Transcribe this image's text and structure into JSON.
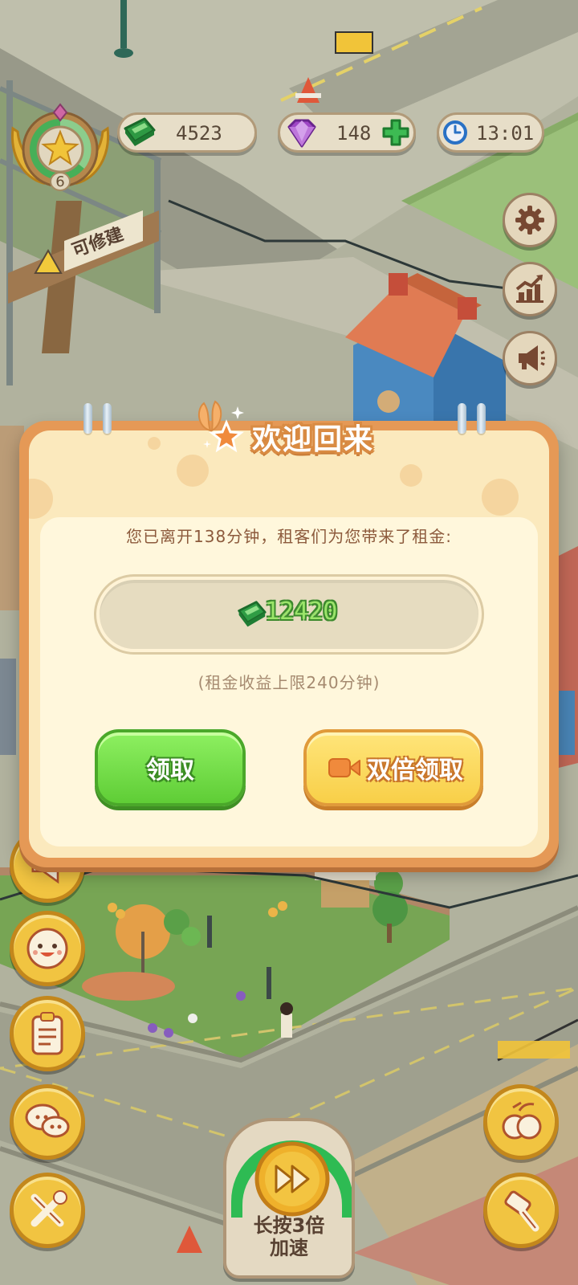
{
  "hud": {
    "level": "6",
    "cash": "4523",
    "gems": "148",
    "time": "13:01"
  },
  "sign": {
    "construction_label": "可修建"
  },
  "dialog": {
    "title": "欢迎回来",
    "away_message": "您已离开138分钟，租客们为您带来了租金:",
    "reward_amount": "12420",
    "cap_note": "(租金收益上限240分钟)",
    "claim_label": "领取",
    "double_claim_label": "双倍领取"
  },
  "speed_button": {
    "label_line1": "长按3倍",
    "label_line2": "加速"
  },
  "colors": {
    "cash_green": "#3fae45",
    "gem_purple": "#9a3fc4",
    "clock_blue": "#2a74c9",
    "dialog_orange": "#e59956",
    "claim_green": "#5fcd36",
    "double_yellow": "#f8cf48"
  },
  "icons": {
    "cash": "cash-icon",
    "gem": "gem-icon",
    "add_gem": "plus-icon",
    "clock": "clock-icon",
    "settings": "gear-icon",
    "stats": "chart-icon",
    "announce": "megaphone-icon",
    "video": "video-camera-icon",
    "fast_forward": "fast-forward-icon"
  }
}
